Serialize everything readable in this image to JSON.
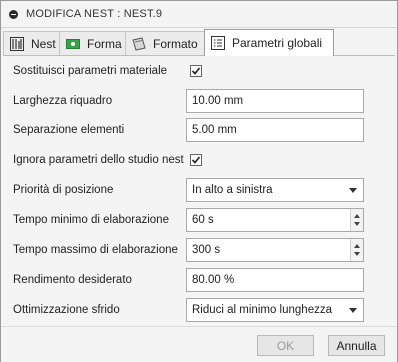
{
  "window": {
    "title": "MODIFICA NEST : NEST.9"
  },
  "tabs": [
    {
      "label": "Nest",
      "icon": "nest-icon"
    },
    {
      "label": "Forma",
      "icon": "shape-icon"
    },
    {
      "label": "Formato",
      "icon": "sheet-icon"
    },
    {
      "label": "Parametri globali",
      "icon": "list-icon",
      "active": true
    }
  ],
  "fields": {
    "material_override": {
      "label": "Sostituisci parametri materiale",
      "checked": true
    },
    "frame_width": {
      "label": "Larghezza riquadro",
      "value": "10.00 mm"
    },
    "part_spacing": {
      "label": "Separazione elementi",
      "value": "5.00 mm"
    },
    "ignore_study": {
      "label": "Ignora parametri dello studio nest",
      "checked": true
    },
    "position_priority": {
      "label": "Priorità di posizione",
      "value": "In alto a sinistra"
    },
    "min_time": {
      "label": "Tempo minimo di elaborazione",
      "value": "60 s"
    },
    "max_time": {
      "label": "Tempo massimo di elaborazione",
      "value": "300 s"
    },
    "yield": {
      "label": "Rendimento desiderato",
      "value": "80.00 %"
    },
    "scrap_opt": {
      "label": "Ottimizzazione sfrido",
      "value": "Riduci al minimo lunghezza"
    }
  },
  "buttons": {
    "ok": "OK",
    "cancel": "Annulla"
  },
  "colors": {
    "tab_green": "#3aa34a",
    "accent_border": "#9c9c9c"
  }
}
